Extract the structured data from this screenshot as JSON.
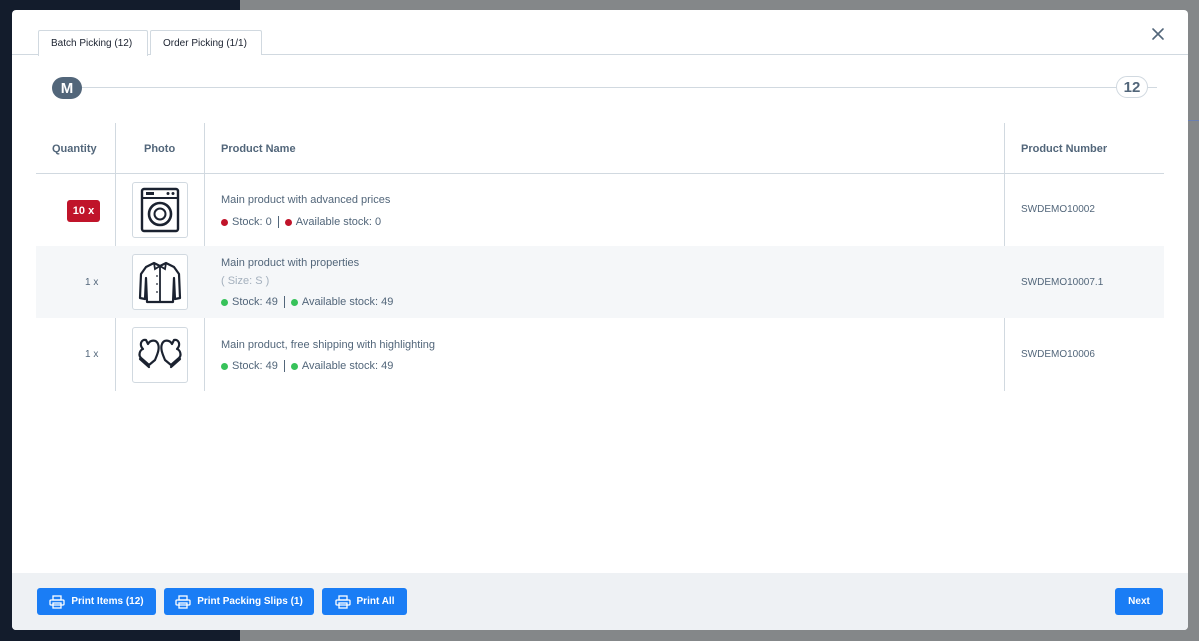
{
  "tabs": [
    {
      "label": "Batch Picking (12)",
      "active": true
    },
    {
      "label": "Order Picking (1/1)",
      "active": false
    }
  ],
  "progress": {
    "start_label": "M",
    "end_label": "12"
  },
  "table": {
    "headers": {
      "quantity": "Quantity",
      "photo": "Photo",
      "product_name": "Product Name",
      "product_number": "Product Number"
    },
    "rows": [
      {
        "quantity": "10 x",
        "quantity_highlight": true,
        "photo_icon": "washing-machine-icon",
        "name": "Main product with advanced prices",
        "option": "",
        "stock": "Stock: 0",
        "available": "Available stock: 0",
        "stock_status_color": "#c0142a",
        "number": "SWDEMO10002"
      },
      {
        "quantity": "1 x",
        "quantity_highlight": false,
        "photo_icon": "jacket-icon",
        "name": "Main product with properties",
        "option": "( Size: S )",
        "stock": "Stock: 49",
        "available": "Available stock: 49",
        "stock_status_color": "#37c25a",
        "number": "SWDEMO10007.1"
      },
      {
        "quantity": "1 x",
        "quantity_highlight": false,
        "photo_icon": "mittens-icon",
        "name": "Main product, free shipping with highlighting",
        "option": "",
        "stock": "Stock: 49",
        "available": "Available stock: 49",
        "stock_status_color": "#37c25a",
        "number": "SWDEMO10006"
      }
    ]
  },
  "footer": {
    "print_items": "Print Items (12)",
    "print_slips": "Print Packing Slips (1)",
    "print_all": "Print All",
    "next": "Next"
  },
  "colors": {
    "primary": "#1a7df5",
    "danger": "#c0142a",
    "success": "#37c25a",
    "text": "#52667a"
  }
}
